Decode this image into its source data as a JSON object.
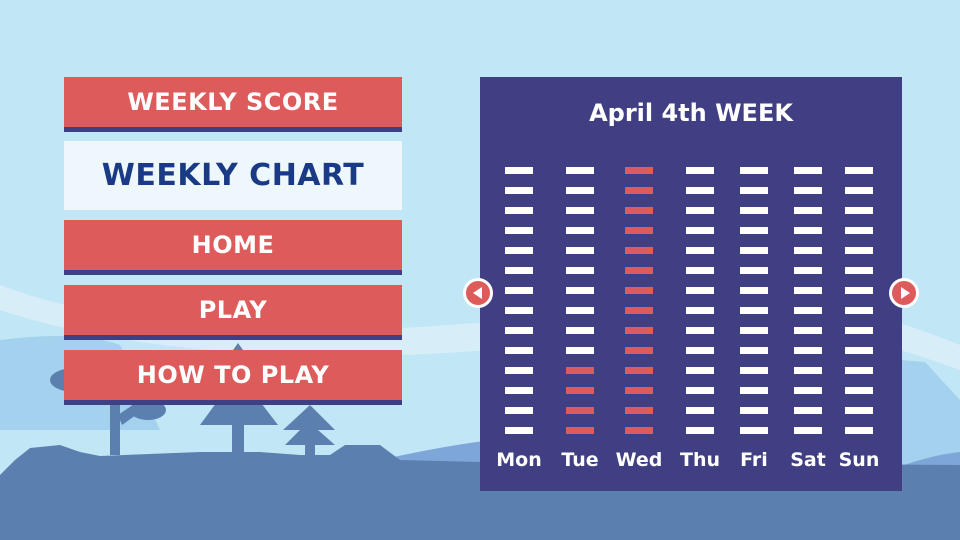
{
  "menu": {
    "weekly_score": "WEEKLY SCORE",
    "weekly_chart": "WEEKLY CHART",
    "home": "HOME",
    "play": "PLAY",
    "how_to_play": "HOW TO PLAY",
    "active": "weekly_chart"
  },
  "colors": {
    "sky": "#c1e6f5",
    "button_red": "#dd5b5b",
    "button_shadow": "#3f3f85",
    "active_bg": "#edf7fc",
    "active_text": "#1b3a86",
    "panel_bg": "#403f83",
    "segment_off": "#ffffff",
    "segment_on": "#dd5b5b",
    "ground": "#5b80b0"
  },
  "icons": {
    "prev": "chevron-left-circle-icon",
    "next": "chevron-right-circle-icon"
  },
  "chart_data": {
    "type": "bar",
    "title": "April 4th WEEK",
    "categories": [
      "Mon",
      "Tue",
      "Wed",
      "Thu",
      "Fri",
      "Sat",
      "Sun"
    ],
    "values": [
      0,
      4,
      14,
      0,
      0,
      0,
      0
    ],
    "max_segments": 14,
    "ylim": [
      0,
      14
    ],
    "xlabel": "",
    "ylabel": "",
    "grid": false,
    "legend": "none"
  }
}
